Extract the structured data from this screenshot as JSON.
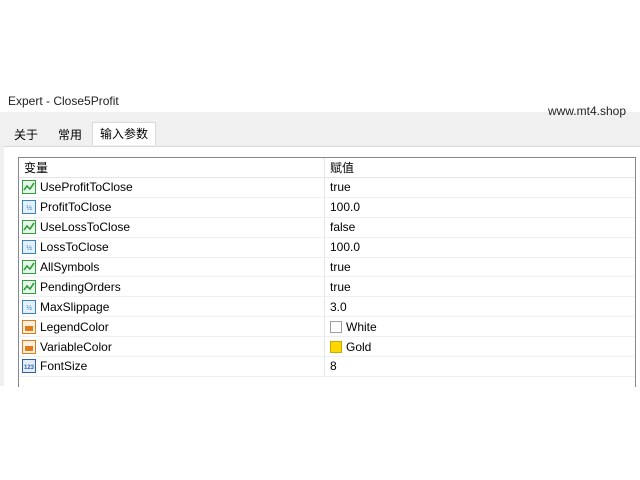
{
  "window": {
    "title": "Expert - Close5Profit"
  },
  "watermark": "www.mt4.shop",
  "tabs": [
    {
      "label": "关于",
      "active": false
    },
    {
      "label": "常用",
      "active": false
    },
    {
      "label": "输入参数",
      "active": true
    }
  ],
  "table": {
    "headers": {
      "variable": "变量",
      "value": "赋值"
    },
    "rows": [
      {
        "name": "UseProfitToClose",
        "value": "true",
        "icon": "bool-icon"
      },
      {
        "name": "ProfitToClose",
        "value": "100.0",
        "icon": "double-icon"
      },
      {
        "name": "UseLossToClose",
        "value": "false",
        "icon": "bool-icon"
      },
      {
        "name": "LossToClose",
        "value": "100.0",
        "icon": "double-icon"
      },
      {
        "name": "AllSymbols",
        "value": "true",
        "icon": "bool-icon"
      },
      {
        "name": "PendingOrders",
        "value": "true",
        "icon": "bool-icon"
      },
      {
        "name": "MaxSlippage",
        "value": "3.0",
        "icon": "double-icon"
      },
      {
        "name": "LegendColor",
        "value": "White",
        "icon": "color-icon",
        "swatch": "#ffffff"
      },
      {
        "name": "VariableColor",
        "value": "Gold",
        "icon": "color-icon",
        "swatch": "#ffd700"
      },
      {
        "name": "FontSize",
        "value": "8",
        "icon": "int-icon"
      }
    ]
  },
  "colors": {
    "bool_icon": "#2e9e3e",
    "double_icon": "#3a7fc4",
    "color_icon": "#e07b1a",
    "int_icon": "#2f5fa8"
  }
}
